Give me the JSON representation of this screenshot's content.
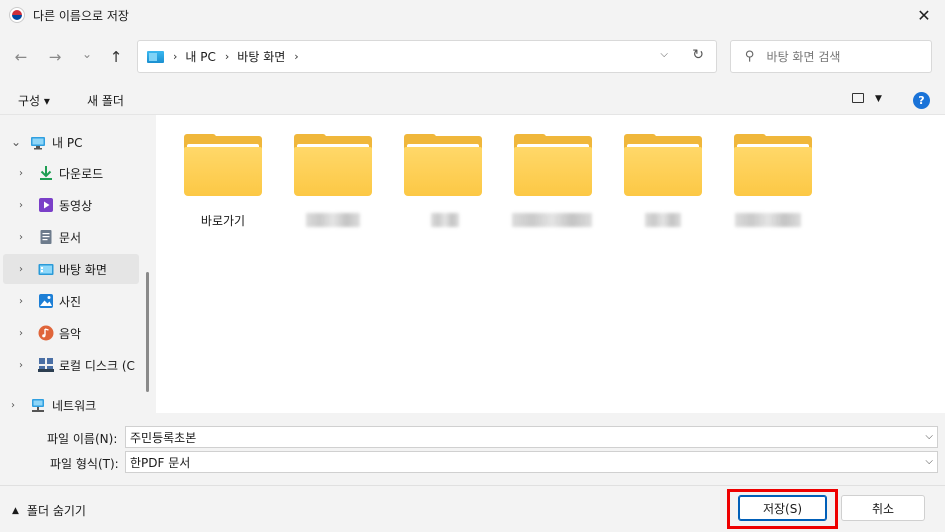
{
  "window": {
    "title": "다른 이름으로 저장",
    "close_glyph": "✕"
  },
  "nav": {
    "back_glyph": "←",
    "forward_glyph": "→",
    "recent_glyph": "⌄",
    "up_glyph": "↑",
    "breadcrumb": [
      "내 PC",
      "바탕 화면"
    ],
    "sep_glyph": "›",
    "dropdown_glyph": "⌵",
    "refresh_glyph": "↻",
    "search_placeholder": "바탕 화면 검색",
    "search_glyph": "⚲"
  },
  "toolbar": {
    "organize": "구성 ▾",
    "new_folder": "새 폴더",
    "view_dd": "▼",
    "help": "?"
  },
  "sidebar": {
    "items": [
      {
        "label": "내 PC",
        "chev": "⌄",
        "icon": "pc-icon"
      },
      {
        "label": "다운로드",
        "chev": "›",
        "icon": "download-icon"
      },
      {
        "label": "동영상",
        "chev": "›",
        "icon": "video-icon"
      },
      {
        "label": "문서",
        "chev": "›",
        "icon": "document-icon"
      },
      {
        "label": "바탕 화면",
        "chev": "›",
        "icon": "desktop-icon"
      },
      {
        "label": "사진",
        "chev": "›",
        "icon": "pictures-icon"
      },
      {
        "label": "음악",
        "chev": "›",
        "icon": "music-icon"
      },
      {
        "label": "로컬 디스크 (C",
        "chev": "›",
        "icon": "disk-icon"
      },
      {
        "label": "네트워크",
        "chev": "›",
        "icon": "network-icon"
      }
    ]
  },
  "folders": [
    {
      "name": "바로가기"
    },
    {
      "name": ""
    },
    {
      "name": ""
    },
    {
      "name": ""
    },
    {
      "name": ""
    },
    {
      "name": ""
    }
  ],
  "fields": {
    "filename_label": "파일 이름(N):",
    "filename_value": "주민등록초본",
    "filetype_label": "파일 형식(T):",
    "filetype_value": "한PDF 문서",
    "dd_glyph": "⌵"
  },
  "footer": {
    "hide_folders": "폴더 숨기기",
    "hide_glyph": "▲",
    "save": "저장(S)",
    "cancel": "취소"
  },
  "colors": {
    "accent": "#005fb8",
    "highlight": "#ee0000",
    "folder": "#fcc845"
  }
}
